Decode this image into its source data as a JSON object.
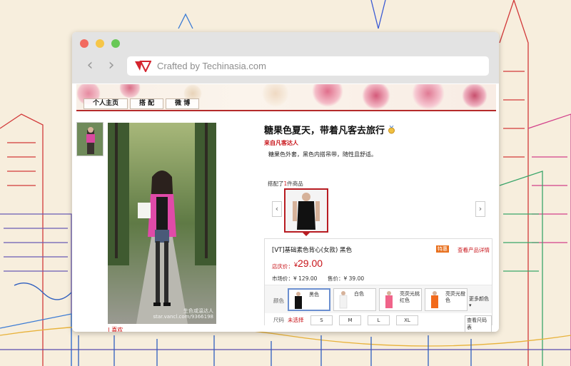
{
  "browser": {
    "url": "Crafted by Techinasia.com"
  },
  "site": {
    "tabs": [
      "个人主页",
      "搭 配",
      "微 博"
    ]
  },
  "post": {
    "title": "糖果色夏天，带着凡客去旅行",
    "from": "来自凡客达人",
    "description": "糖果色外套，黑色内搭吊带，随性且舒适。",
    "photo_caption_1": "生色或温达人",
    "photo_caption_2": "star.vancl.com/9366198",
    "below_photo": "| 喜欢"
  },
  "matched": {
    "prefix": "搭配了",
    "count": "1",
    "suffix": "件商品"
  },
  "product": {
    "name": "[VT]基础素色背心(女款) 黑色",
    "promo_badge": "特惠",
    "detail_link": "查看产品详情",
    "price_label": "店庆价：",
    "currency": "¥",
    "price": "29.00",
    "market_price": "市场价：¥ 129.00",
    "sale_price": "售价：¥ 39.00",
    "color_label": "颜色",
    "colors": [
      {
        "name": "黑色",
        "hex": "#111111"
      },
      {
        "name": "白色",
        "hex": "#f2f2f2"
      },
      {
        "name": "亮荧光桃红色",
        "hex": "#f0648a"
      },
      {
        "name": "亮荧光橙色",
        "hex": "#f26a1b"
      }
    ],
    "more_colors": "更多颜色",
    "size_label": "尺码",
    "size_unselected": "未选择",
    "sizes": [
      "S",
      "M",
      "L",
      "XL"
    ],
    "size_chart": "查看尺码表"
  },
  "colors": {
    "accent": "#c8141a",
    "banner_rule": "#b52b2b"
  }
}
